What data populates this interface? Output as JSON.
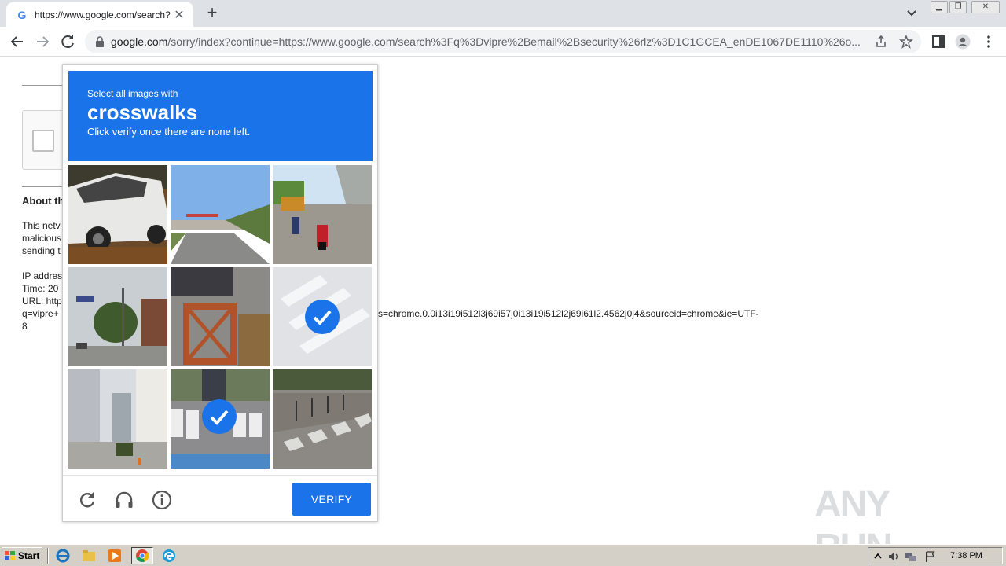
{
  "browser": {
    "tab": {
      "title": "https://www.google.com/search?q=",
      "favicon": "google-g-icon"
    },
    "url": {
      "host": "google.com",
      "path": "/sorry/index?continue=https://www.google.com/search%3Fq%3Dvipre%2Bemail%2Bsecurity%26rlz%3D1C1GCEA_enDE1067DE1110%26o..."
    }
  },
  "page": {
    "about_heading": "About th",
    "body_lines": [
      "This netv",
      "malicious",
      "sending t"
    ],
    "ip_line": "IP addres",
    "time_line": "Time: 20",
    "url_line": "URL: http",
    "query_line": "q=vipre+",
    "query_tail": "s=chrome.0.0i13i19i512l3j69i57j0i13i19i512l2j69i61l2.4562j0j4&sourceid=chrome&ie=UTF-",
    "query_end": "8"
  },
  "captcha": {
    "subtitle": "Select all images with",
    "target": "crosswalks",
    "hint": "Click verify once there are none left.",
    "verify_label": "VERIFY",
    "selected_tiles": [
      5,
      7
    ],
    "accent": "#1a73e8"
  },
  "watermark": {
    "text": "ANY RUN"
  },
  "taskbar": {
    "start_label": "Start",
    "clock": "7:38 PM"
  },
  "colors": {
    "tab_strip": "#dee1e6",
    "omnibox": "#f1f3f4",
    "taskbar": "#d4d0c8"
  }
}
